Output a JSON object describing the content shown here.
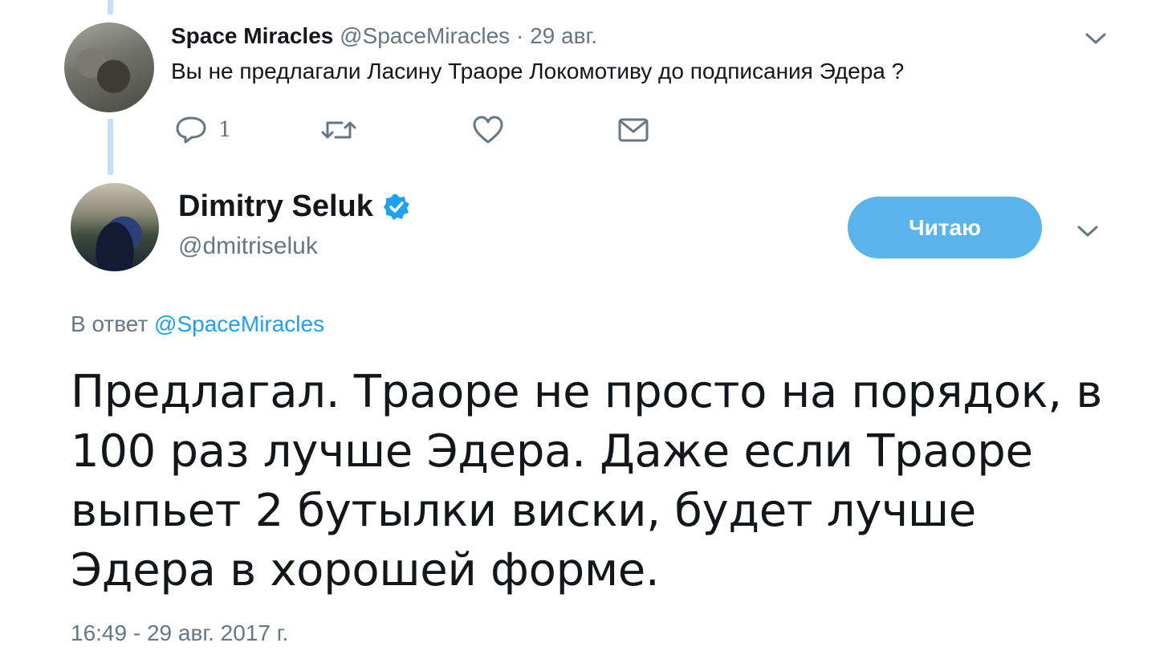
{
  "parent_tweet": {
    "name": "Space Miracles",
    "handle": "@SpaceMiracles",
    "date": "29 авг.",
    "separator": "·",
    "text": "Вы не предлагали Ласину Траоре Локомотиву до подписания Эдера ?",
    "actions": {
      "reply_icon": "reply-icon",
      "reply_count": "1",
      "retweet_icon": "retweet-icon",
      "like_icon": "heart-icon",
      "dm_icon": "envelope-icon"
    }
  },
  "main_tweet": {
    "name": "Dimitry Seluk",
    "verified_icon": "verified-badge-icon",
    "handle": "@dmitriseluk",
    "follow_button": "Читаю",
    "reply_prefix": "В ответ",
    "reply_to_handle": "@SpaceMiracles",
    "text": "Предлагал. Траоре не просто на порядок, в 100 раз лучше Эдера. Даже если Траоре выпьет 2 бутылки виски, будет лучше Эдера в хорошей форме.",
    "timestamp": "16:49 - 29 авг. 2017 г."
  },
  "colors": {
    "accent": "#1da1f2",
    "button": "#58b4eb",
    "muted": "#657786",
    "thread_line": "#c4dff6"
  }
}
